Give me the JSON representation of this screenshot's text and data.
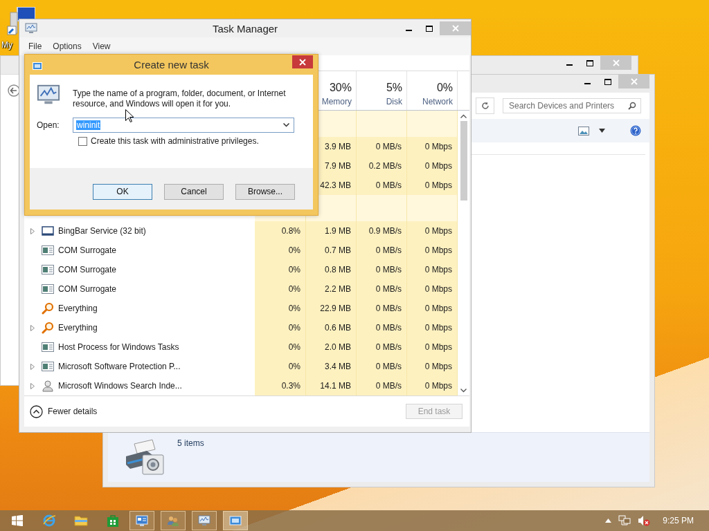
{
  "desktop": {
    "icon_label": "My"
  },
  "devices_window": {
    "search": {
      "placeholder": "Search Devices and Printers"
    },
    "details": {
      "item_count": "5 items"
    }
  },
  "task_manager": {
    "title": "Task Manager",
    "menu": [
      "File",
      "Options",
      "View"
    ],
    "columns": [
      {
        "percent": "30%",
        "label": "Memory"
      },
      {
        "percent": "5%",
        "label": "Disk"
      },
      {
        "percent": "0%",
        "label": "Network"
      }
    ],
    "rows": [
      {
        "kind": "group"
      },
      {
        "kind": "hidden",
        "memory": "3.9 MB",
        "disk": "0 MB/s",
        "network": "0 Mbps"
      },
      {
        "kind": "hidden",
        "memory": "7.9 MB",
        "disk": "0.2 MB/s",
        "network": "0 Mbps"
      },
      {
        "kind": "hidden",
        "memory": "42.3 MB",
        "disk": "0 MB/s",
        "network": "0 Mbps"
      },
      {
        "kind": "group"
      },
      {
        "kind": "app-window",
        "expandable": true,
        "name": "BingBar Service (32 bit)",
        "cpu": "0.8%",
        "memory": "1.9 MB",
        "disk": "0.9 MB/s",
        "network": "0 Mbps"
      },
      {
        "kind": "service",
        "expandable": false,
        "name": "COM Surrogate",
        "cpu": "0%",
        "memory": "0.7 MB",
        "disk": "0 MB/s",
        "network": "0 Mbps"
      },
      {
        "kind": "service",
        "expandable": false,
        "name": "COM Surrogate",
        "cpu": "0%",
        "memory": "0.8 MB",
        "disk": "0 MB/s",
        "network": "0 Mbps"
      },
      {
        "kind": "service",
        "expandable": false,
        "name": "COM Surrogate",
        "cpu": "0%",
        "memory": "2.2 MB",
        "disk": "0 MB/s",
        "network": "0 Mbps"
      },
      {
        "kind": "search-tool",
        "expandable": false,
        "name": "Everything",
        "cpu": "0%",
        "memory": "22.9 MB",
        "disk": "0 MB/s",
        "network": "0 Mbps"
      },
      {
        "kind": "search-tool",
        "expandable": true,
        "name": "Everything",
        "cpu": "0%",
        "memory": "0.6 MB",
        "disk": "0 MB/s",
        "network": "0 Mbps"
      },
      {
        "kind": "service",
        "expandable": false,
        "name": "Host Process for Windows Tasks",
        "cpu": "0%",
        "memory": "2.0 MB",
        "disk": "0 MB/s",
        "network": "0 Mbps"
      },
      {
        "kind": "service",
        "expandable": true,
        "name": "Microsoft Software Protection P...",
        "cpu": "0%",
        "memory": "3.4 MB",
        "disk": "0 MB/s",
        "network": "0 Mbps"
      },
      {
        "kind": "indexer",
        "expandable": true,
        "name": "Microsoft Windows Search Inde...",
        "cpu": "0.3%",
        "memory": "14.1 MB",
        "disk": "0 MB/s",
        "network": "0 Mbps"
      }
    ],
    "footer": {
      "details_toggle": "Fewer details",
      "end_task": {
        "label": "End task",
        "disabled": true
      }
    }
  },
  "dialog": {
    "title": "Create new task",
    "message": "Type the name of a program, folder, document, or Internet resource, and Windows will open it for you.",
    "open_label": "Open:",
    "value": "wininit",
    "admin": {
      "label": "Create this task with administrative privileges.",
      "checked": false
    },
    "buttons": [
      {
        "label": "OK",
        "default": true
      },
      {
        "label": "Cancel",
        "default": false
      },
      {
        "label": "Browse...",
        "default": false
      }
    ]
  },
  "taskbar": {
    "items": [
      {
        "kind": "start",
        "running": false,
        "selected": false
      },
      {
        "kind": "browser",
        "running": false,
        "selected": false
      },
      {
        "kind": "folder",
        "running": false,
        "selected": false
      },
      {
        "kind": "store",
        "running": false,
        "selected": false
      },
      {
        "kind": "control-panel",
        "running": true,
        "selected": false
      },
      {
        "kind": "users",
        "running": true,
        "selected": false
      },
      {
        "kind": "task-manager",
        "running": true,
        "selected": false
      },
      {
        "kind": "run-dialog",
        "running": true,
        "selected": true
      }
    ],
    "clock": "9:25 PM"
  }
}
